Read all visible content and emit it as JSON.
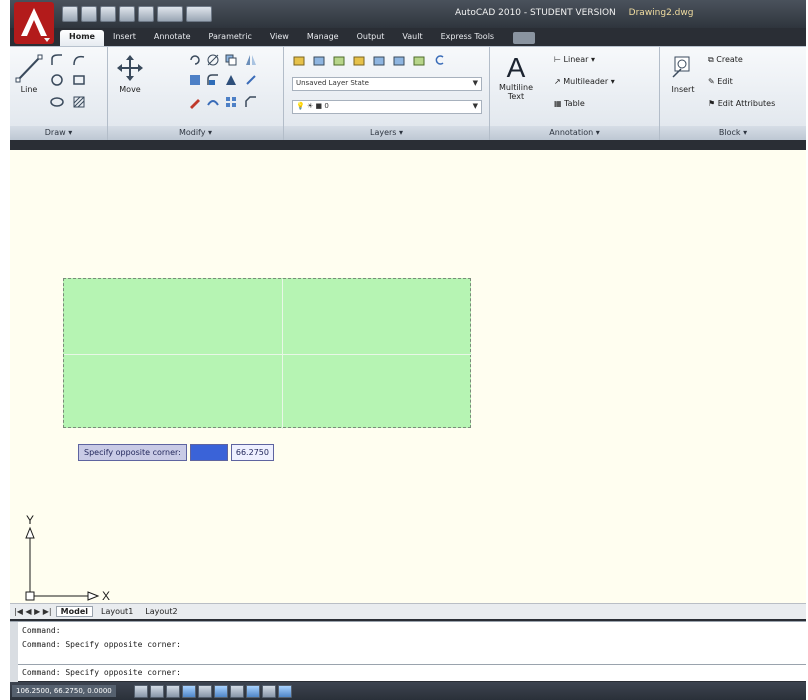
{
  "window": {
    "title": "AutoCAD 2010 - STUDENT VERSION",
    "document": "Drawing2.dwg"
  },
  "colors": {
    "titlebar": "#2f353d",
    "canvas_background": "#fffef0",
    "selection_fill": "#b6f4b3",
    "prompt_highlight": "#3a63d8"
  },
  "quick_access": {
    "icons": [
      "new-icon",
      "open-icon",
      "save-icon",
      "undo-icon",
      "redo-icon",
      "plot-icon",
      "workspace-icon"
    ]
  },
  "ribbon": {
    "tabs": [
      {
        "label": "Home"
      },
      {
        "label": "Insert"
      },
      {
        "label": "Annotate"
      },
      {
        "label": "Parametric"
      },
      {
        "label": "View"
      },
      {
        "label": "Manage"
      },
      {
        "label": "Output"
      },
      {
        "label": "Vault"
      },
      {
        "label": "Express Tools"
      }
    ],
    "active_tab": "Home",
    "panels": {
      "draw": {
        "title": "Draw ▾",
        "line_label": "Line"
      },
      "modify": {
        "title": "Modify ▾",
        "move_label": "Move"
      },
      "layers": {
        "title": "Layers ▾",
        "layer_state": "Unsaved Layer State",
        "current_layer": "0"
      },
      "annotation": {
        "title": "Annotation ▾",
        "multiline_text_label": "Multiline Text",
        "linear_label": "Linear",
        "multileader_label": "Multileader",
        "table_label": "Table"
      },
      "block": {
        "title": "Block ▾",
        "insert_label": "Insert",
        "create_label": "Create",
        "edit_label": "Edit",
        "edit_attributes_label": "Edit Attributes"
      }
    }
  },
  "canvas": {
    "dynamic_prompt": {
      "label": "Specify opposite corner:",
      "x_value": "",
      "y_value": "66.2750"
    },
    "ucs": {
      "x_label": "X",
      "y_label": "Y"
    }
  },
  "layout_tabs": {
    "nav": "|◀ ◀ ▶ ▶|",
    "tabs": [
      {
        "label": "Model"
      },
      {
        "label": "Layout1"
      },
      {
        "label": "Layout2"
      }
    ],
    "active": "Model"
  },
  "command_line": {
    "history": [
      "Command:",
      "Command: Specify opposite corner:",
      "Command: Specify opposite corner:"
    ]
  },
  "status_bar": {
    "coordinates": "106.2500, 66.2750, 0.0000",
    "toggles": [
      "snap-icon",
      "grid-icon",
      "ortho-icon",
      "polar-icon",
      "osnap-icon",
      "otrack-icon",
      "ducs-icon",
      "dyn-icon",
      "lwt-icon",
      "qp-icon"
    ]
  }
}
